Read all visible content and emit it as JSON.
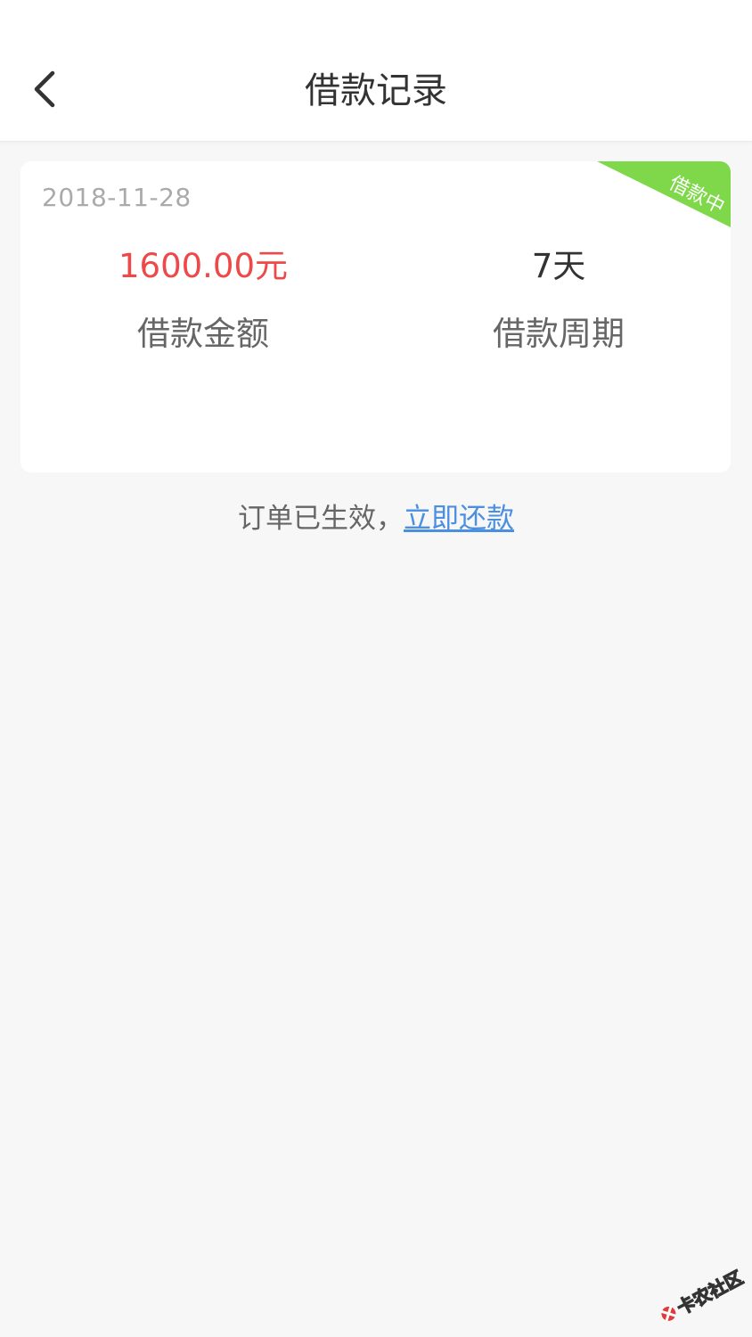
{
  "header": {
    "title": "借款记录",
    "back_icon": "chevron-left-icon"
  },
  "record": {
    "date": "2018-11-28",
    "status": "借款中",
    "status_color": "#7ed84a",
    "amount_value": "1600.00元",
    "amount_label": "借款金额",
    "amount_color": "#ee4848",
    "period_value": "7天",
    "period_label": "借款周期"
  },
  "notice": {
    "text": "订单已生效，",
    "link_text": "立即还款",
    "link_color": "#4a8fe0"
  },
  "watermark": {
    "text": "卡农社区"
  }
}
